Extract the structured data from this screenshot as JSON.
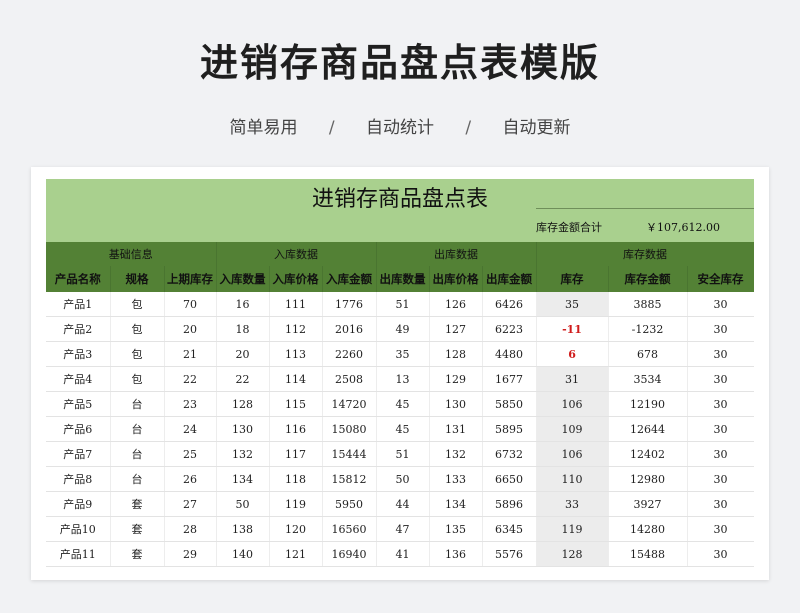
{
  "page": {
    "title": "进销存商品盘点表模版",
    "tags": [
      "简单易用",
      "自动统计",
      "自动更新"
    ],
    "separator": "/"
  },
  "sheet": {
    "title": "进销存商品盘点表",
    "total_label": "库存金额合计",
    "total_value": "￥107,612.00",
    "groups": [
      "基础信息",
      "入库数据",
      "出库数据",
      "库存数据"
    ],
    "columns": [
      "产品名称",
      "规格",
      "上期库存",
      "入库数量",
      "入库价格",
      "入库金额",
      "出库数量",
      "出库价格",
      "出库金额",
      "库存",
      "库存金额",
      "安全库存"
    ],
    "rows": [
      [
        "产品1",
        "包",
        "70",
        "16",
        "111",
        "1776",
        "51",
        "126",
        "6426",
        "35",
        "3885",
        "30"
      ],
      [
        "产品2",
        "包",
        "20",
        "18",
        "112",
        "2016",
        "49",
        "127",
        "6223",
        "-11",
        "-1232",
        "30"
      ],
      [
        "产品3",
        "包",
        "21",
        "20",
        "113",
        "2260",
        "35",
        "128",
        "4480",
        "6",
        "678",
        "30"
      ],
      [
        "产品4",
        "包",
        "22",
        "22",
        "114",
        "2508",
        "13",
        "129",
        "1677",
        "31",
        "3534",
        "30"
      ],
      [
        "产品5",
        "台",
        "23",
        "128",
        "115",
        "14720",
        "45",
        "130",
        "5850",
        "106",
        "12190",
        "30"
      ],
      [
        "产品6",
        "台",
        "24",
        "130",
        "116",
        "15080",
        "45",
        "131",
        "5895",
        "109",
        "12644",
        "30"
      ],
      [
        "产品7",
        "台",
        "25",
        "132",
        "117",
        "15444",
        "51",
        "132",
        "6732",
        "106",
        "12402",
        "30"
      ],
      [
        "产品8",
        "台",
        "26",
        "134",
        "118",
        "15812",
        "50",
        "133",
        "6650",
        "110",
        "12980",
        "30"
      ],
      [
        "产品9",
        "套",
        "27",
        "50",
        "119",
        "5950",
        "44",
        "134",
        "5896",
        "33",
        "3927",
        "30"
      ],
      [
        "产品10",
        "套",
        "28",
        "138",
        "120",
        "16560",
        "47",
        "135",
        "6345",
        "119",
        "14280",
        "30"
      ],
      [
        "产品11",
        "套",
        "29",
        "140",
        "121",
        "16940",
        "41",
        "136",
        "5576",
        "128",
        "15488",
        "30"
      ]
    ],
    "low_stock_rows": [
      1,
      2
    ],
    "colors": {
      "banner": "#a9d08e",
      "header": "#538135",
      "alert": "#d01c1c",
      "stock_cell": "#ececec"
    }
  }
}
